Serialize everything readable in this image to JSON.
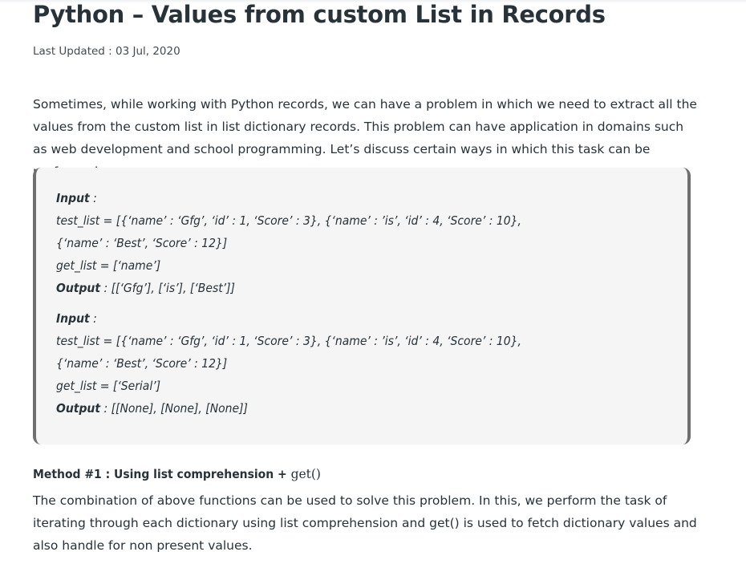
{
  "article": {
    "title": "Python – Values from custom List in Records",
    "last_updated": "Last Updated : 03 Jul, 2020",
    "intro": "Sometimes, while working with Python records, we can have a problem in which we need to extract all the values from the custom list in list dictionary records. This problem can have application in domains such as web development and school programming. Let’s discuss certain ways in which this task can be performed."
  },
  "examples": [
    {
      "input_label": "Input",
      "input_sep": " :",
      "test_list_line1": "test_list = [{‘name’ : ‘Gfg’, ‘id’ : 1, ‘Score’ : 3}, {‘name’ : ’is’, ‘id’ : 4, ‘Score’ : 10},",
      "test_list_line2": "{‘name’ : ‘Best’, ‘Score’ : 12}]",
      "get_list": "get_list = [‘name’]",
      "output_label": "Output",
      "output_value": " : [[‘Gfg’], [‘is’], [‘Best’]]"
    },
    {
      "input_label": "Input",
      "input_sep": " :",
      "test_list_line1": "test_list = [{‘name’ : ‘Gfg’, ‘id’ : 1, ‘Score’ : 3}, {‘name’ : ’is’, ‘id’ : 4, ‘Score’ : 10},",
      "test_list_line2": "{‘name’ : ‘Best’, ‘Score’ : 12}]",
      "get_list": "get_list = [‘Serial’]",
      "output_label": "Output",
      "output_value": " : [[None], [None], [None]]"
    }
  ],
  "method1": {
    "heading": "Method #1 : Using list comprehension + ",
    "heading_code": "get()",
    "description": "The combination of above functions can be used to solve this problem. In this, we perform the task of iterating through each dictionary using list comprehension and get() is used to fetch dictionary values and also handle for non present values."
  },
  "colors": {
    "text": "#273239",
    "box_background": "#f5f5f5",
    "box_border": "#6f6f6f"
  }
}
